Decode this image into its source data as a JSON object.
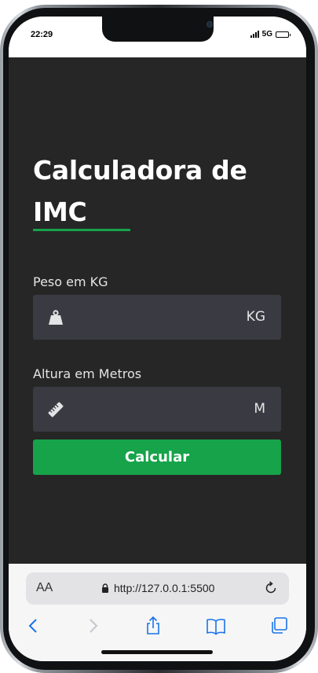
{
  "status_bar": {
    "time": "22:29",
    "network": "5G",
    "signal_bars": 4,
    "battery_level": 0.9
  },
  "app": {
    "title_line1": "Calculadora de",
    "title_line2": "IMC",
    "accent_color": "#16a34a",
    "background_color": "#262626",
    "weight_field": {
      "label": "Peso em KG",
      "icon": "weight-icon",
      "value": "",
      "unit": "KG"
    },
    "height_field": {
      "label": "Altura em Metros",
      "icon": "ruler-icon",
      "value": "",
      "unit": "M"
    },
    "calculate_label": "Calcular"
  },
  "browser": {
    "text_size_button": "AA",
    "url": "http://127.0.0.1:5500",
    "icons": [
      "lock-icon",
      "reload-icon",
      "back-icon",
      "forward-icon",
      "share-icon",
      "bookmarks-icon",
      "tabs-icon"
    ]
  }
}
